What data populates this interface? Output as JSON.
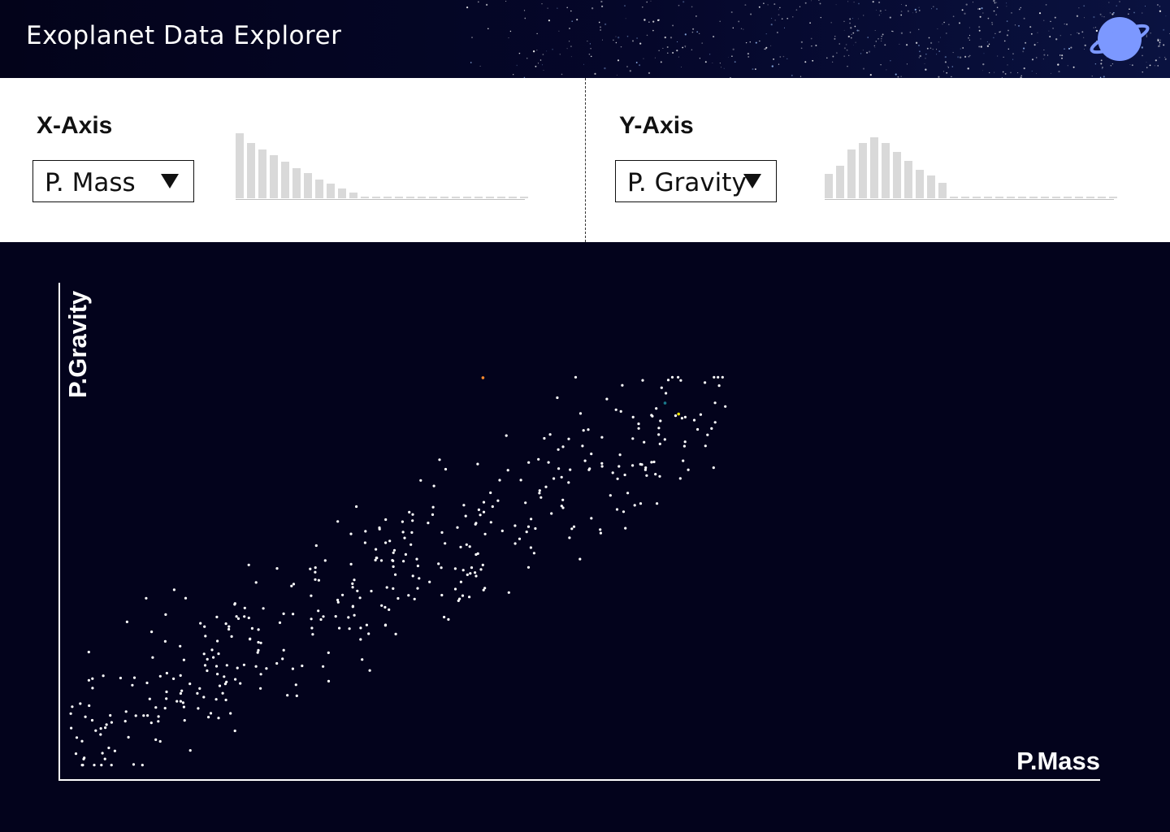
{
  "app": {
    "title": "Exoplanet Data Explorer",
    "logo_icon": "planet-icon"
  },
  "x_axis": {
    "label": "X-Axis",
    "selected": "P. Mass",
    "histogram": [
      80,
      68,
      60,
      53,
      45,
      37,
      31,
      23,
      18,
      12,
      7,
      2,
      2,
      2,
      2,
      2,
      2,
      2,
      2,
      2,
      2,
      2,
      2,
      2,
      2,
      2
    ]
  },
  "y_axis": {
    "label": "Y-Axis",
    "selected": "P. Gravity",
    "histogram": [
      30,
      40,
      60,
      68,
      75,
      68,
      57,
      46,
      35,
      28,
      19,
      2,
      2,
      2,
      2,
      2,
      2,
      2,
      2,
      2,
      2,
      2,
      2,
      2,
      2,
      2
    ]
  },
  "colors": {
    "background": "#03031c",
    "panel": "#ffffff",
    "histogram_bar": "#d9d9d9",
    "point": "#ffffff",
    "accent_orange": "#ff8c2e",
    "accent_yellow": "#f2e600",
    "accent_teal": "#1a7a8c",
    "logo": "#7c98ff"
  },
  "chart_data": {
    "type": "scatter",
    "xlabel": "P.Mass",
    "ylabel": "P.Gravity",
    "xlim": [
      0,
      100
    ],
    "ylim": [
      0,
      100
    ],
    "grid": false,
    "point_count": 420,
    "highlights": [
      {
        "color": "#ff8c2e",
        "x": 40.7,
        "y": 80.9
      },
      {
        "color": "#f2e600",
        "x": 59.5,
        "y": 73.6
      },
      {
        "color": "#1a7a8c",
        "x": 58.2,
        "y": 75.8
      }
    ]
  }
}
